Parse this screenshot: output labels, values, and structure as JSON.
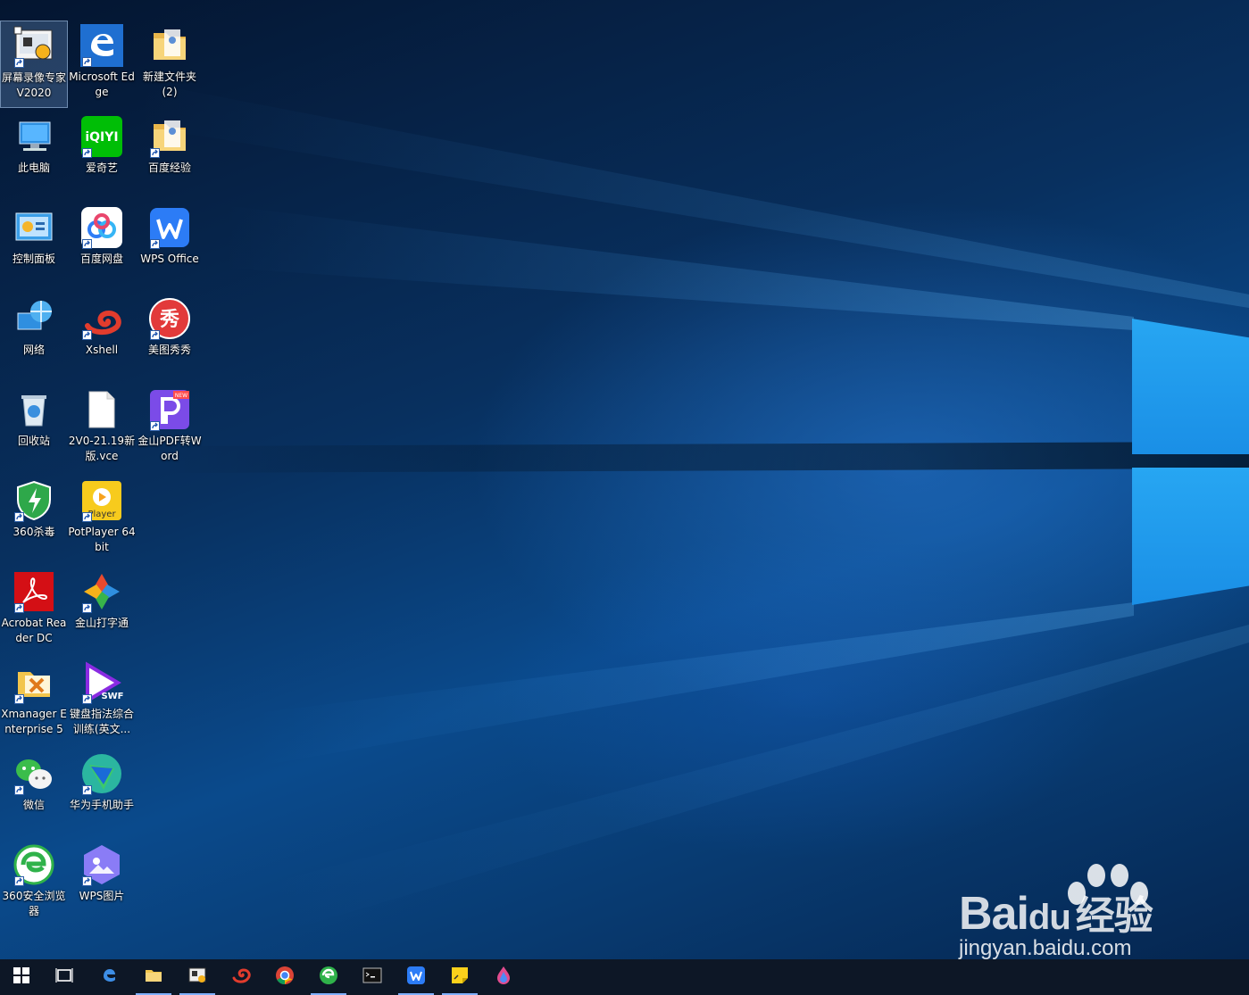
{
  "desktop": {
    "wallpaper": "Windows 10 hero wallpaper",
    "icons": [
      {
        "label": "屏幕录像专家V2020",
        "icon": "screen-recorder-icon",
        "shortcut": true,
        "selected": true
      },
      {
        "label": "Microsoft Edge",
        "icon": "edge-icon",
        "shortcut": true
      },
      {
        "label": "新建文件夹 (2)",
        "icon": "folder-icon",
        "shortcut": false
      },
      {
        "label": "此电脑",
        "icon": "computer-icon",
        "shortcut": false
      },
      {
        "label": "爱奇艺",
        "icon": "iqiyi-icon",
        "shortcut": true,
        "text": "iQIYI"
      },
      {
        "label": "百度经验",
        "icon": "folder-icon",
        "shortcut": true
      },
      {
        "label": "控制面板",
        "icon": "control-panel-icon",
        "shortcut": false
      },
      {
        "label": "百度网盘",
        "icon": "baidu-netdisk-icon",
        "shortcut": true
      },
      {
        "label": "WPS Office",
        "icon": "wps-icon",
        "shortcut": true
      },
      {
        "label": "网络",
        "icon": "network-icon",
        "shortcut": false
      },
      {
        "label": "Xshell",
        "icon": "xshell-icon",
        "shortcut": true
      },
      {
        "label": "美图秀秀",
        "icon": "meitu-icon",
        "shortcut": true,
        "text": "秀"
      },
      {
        "label": "回收站",
        "icon": "recycle-bin-icon",
        "shortcut": false
      },
      {
        "label": "2V0-21.19新版.vce",
        "icon": "file-icon",
        "shortcut": false
      },
      {
        "label": "金山PDF转Word",
        "icon": "pdf-converter-icon",
        "shortcut": true,
        "text": "NEW"
      },
      {
        "label": "360杀毒",
        "icon": "antivirus-icon",
        "shortcut": true
      },
      {
        "label": "PotPlayer 64 bit",
        "icon": "potplayer-icon",
        "shortcut": true,
        "text": "Player"
      },
      {
        "label": "Acrobat Reader DC",
        "icon": "acrobat-icon",
        "shortcut": true
      },
      {
        "label": "金山打字通",
        "icon": "typing-icon",
        "shortcut": true
      },
      {
        "label": "Xmanager Enterprise 5",
        "icon": "xmanager-icon",
        "shortcut": true
      },
      {
        "label": "键盘指法综合训练(英文...",
        "icon": "swf-icon",
        "shortcut": true,
        "text": "SWF"
      },
      {
        "label": "微信",
        "icon": "wechat-icon",
        "shortcut": true
      },
      {
        "label": "华为手机助手",
        "icon": "huawei-assistant-icon",
        "shortcut": true
      },
      {
        "label": "360安全浏览器",
        "icon": "360-browser-icon",
        "shortcut": true
      },
      {
        "label": "WPS图片",
        "icon": "wps-photos-icon",
        "shortcut": true
      }
    ]
  },
  "taskbar": {
    "items": [
      {
        "name": "start-button",
        "icon": "windows-logo-icon"
      },
      {
        "name": "task-view-button",
        "icon": "task-view-icon"
      },
      {
        "name": "taskbar-edge",
        "icon": "edge-icon"
      },
      {
        "name": "taskbar-file-explorer",
        "icon": "folder-icon",
        "running": true
      },
      {
        "name": "taskbar-screen-recorder",
        "icon": "screen-recorder-icon",
        "running": true
      },
      {
        "name": "taskbar-xshell",
        "icon": "xshell-icon"
      },
      {
        "name": "taskbar-chrome",
        "icon": "chrome-icon"
      },
      {
        "name": "taskbar-360-browser",
        "icon": "360-browser-icon",
        "running": true
      },
      {
        "name": "taskbar-terminal",
        "icon": "terminal-icon"
      },
      {
        "name": "taskbar-wps",
        "icon": "wps-icon",
        "running": true
      },
      {
        "name": "taskbar-sticky-notes",
        "icon": "sticky-notes-icon",
        "running": true
      },
      {
        "name": "taskbar-paint-app",
        "icon": "paint-drop-icon"
      }
    ]
  },
  "watermark": {
    "brand": "Bai",
    "brand2": "du",
    "brand_cn": "经验",
    "url": "jingyan.baidu.com"
  }
}
